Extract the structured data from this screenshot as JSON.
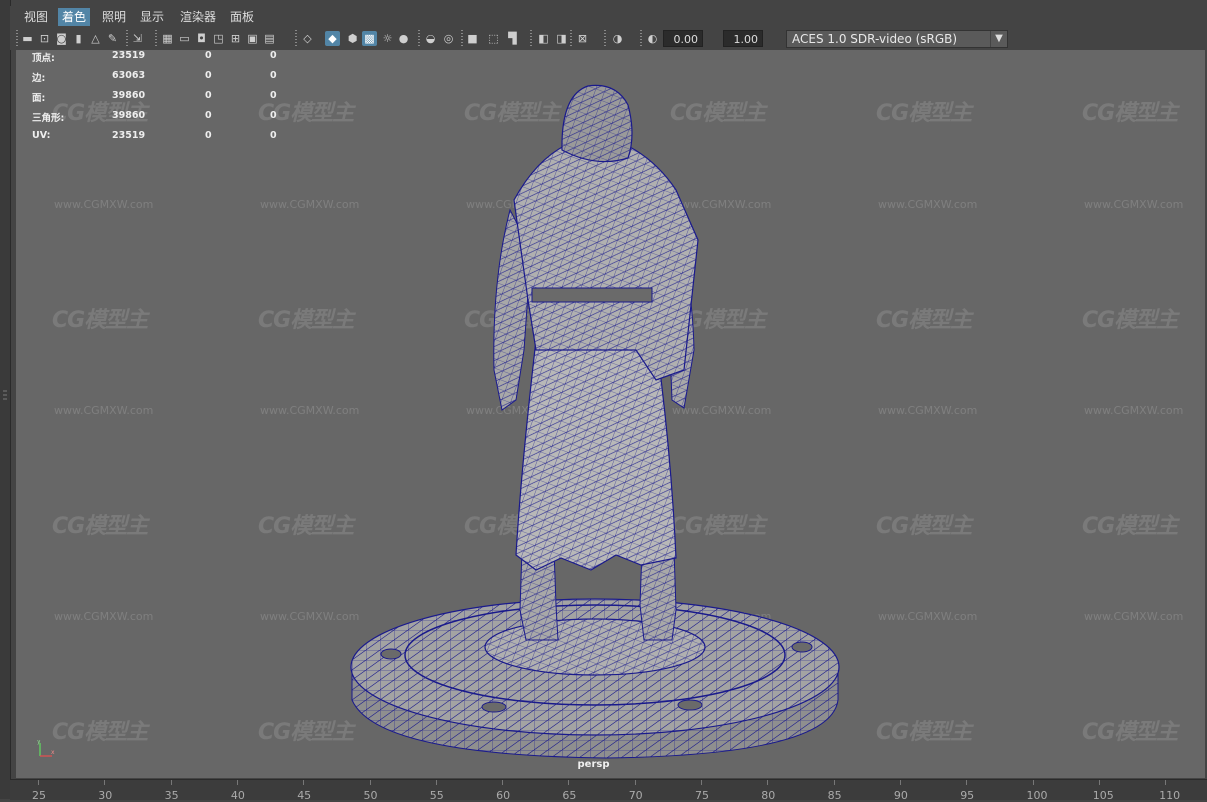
{
  "menu": [
    "视图",
    "着色",
    "照明",
    "显示",
    "渲染器",
    "面板"
  ],
  "menu_active_index": 1,
  "toolbar": {
    "exposure_value": "0.00",
    "gamma_value": "1.00",
    "color_space": "ACES 1.0 SDR-video (sRGB)",
    "icons": [
      "camera-select-icon",
      "camera-lock-icon",
      "camera-attributes-icon",
      "bookmark-icon",
      "image-plane-icon",
      "grease-pencil-icon",
      "2d-pan-zoom-icon",
      "grid-icon",
      "film-gate-icon",
      "resolution-gate-icon",
      "gate-mask-icon",
      "field-chart-icon",
      "safe-action-icon",
      "safe-title-icon",
      "wireframe-icon",
      "smooth-shade-icon",
      "wireframe-on-shaded-icon",
      "textured-icon",
      "use-all-lights-icon",
      "shadows-icon",
      "screen-space-ao-icon",
      "motion-blur-icon",
      "multisample-aa-icon",
      "depth-of-field-icon",
      "isolate-select-icon",
      "xray-icon",
      "xray-joints-icon",
      "xray-components-icon",
      "exposure-icon",
      "gamma-icon",
      "color-management-icon"
    ]
  },
  "hud": {
    "rows": [
      {
        "label": "顶点:",
        "a": "23519",
        "b": "0",
        "c": "0"
      },
      {
        "label": "边:",
        "a": "63063",
        "b": "0",
        "c": "0"
      },
      {
        "label": "面:",
        "a": "39860",
        "b": "0",
        "c": "0"
      },
      {
        "label": "三角形:",
        "a": "39860",
        "b": "0",
        "c": "0"
      },
      {
        "label": "UV:",
        "a": "23519",
        "b": "0",
        "c": "0"
      }
    ]
  },
  "watermark": {
    "logo": "CG模型主",
    "url": "www.CGMXW.com"
  },
  "camera_label": "persp",
  "axis": {
    "y": "y",
    "x": "x"
  },
  "timeline_numbers": [
    "25",
    "30",
    "35",
    "40",
    "45",
    "50",
    "55",
    "60",
    "65",
    "70",
    "75",
    "80",
    "85",
    "90",
    "95",
    "100",
    "105",
    "110"
  ],
  "colors": {
    "wire": "#1a1a8c",
    "viewport_bg": "#676767",
    "highlight": "#5285a6"
  }
}
